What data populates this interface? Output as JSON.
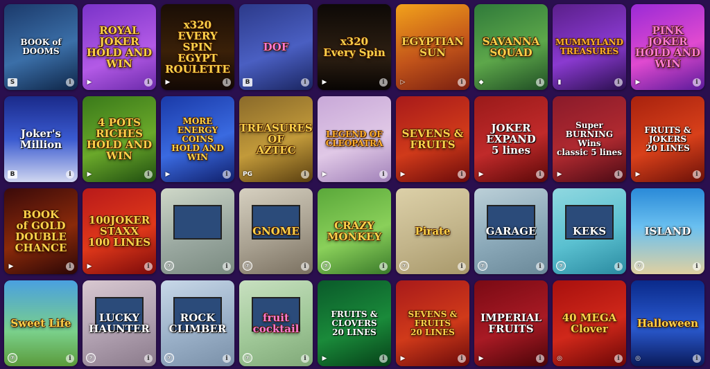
{
  "games": [
    {
      "title": "BOOK of DOOMS",
      "provider": "S",
      "pstyle": "box",
      "bg": "linear-gradient(160deg,#1b3a6b,#3b6fa8 55%,#0e2547)",
      "tcls": "white small"
    },
    {
      "title": "ROYAL\nJOKER\nHOLD AND WIN",
      "provider": "▶",
      "pstyle": "plain",
      "bg": "linear-gradient(160deg,#7a33c9,#b35ae6 60%,#6b2aaa)",
      "tcls": "gold"
    },
    {
      "title": "x320\nEVERY SPIN\nEGYPT ROULETTE",
      "provider": "▶",
      "pstyle": "plain",
      "bg": "linear-gradient(180deg,#1a0e06,#3a2008 55%,#120804)",
      "tcls": "gold"
    },
    {
      "title": "DOF",
      "provider": "B",
      "pstyle": "box",
      "bg": "linear-gradient(160deg,#2c3a8a,#4a5fc2 55%,#1a2560)",
      "tcls": "pink"
    },
    {
      "title": "x320\nEvery Spin",
      "provider": "▶",
      "pstyle": "plain",
      "bg": "linear-gradient(180deg,#0d0906,#2d1f12 60%,#080503)",
      "tcls": "gold"
    },
    {
      "title": "EGYPTIAN\nSUN",
      "provider": "▷",
      "pstyle": "plain",
      "bg": "linear-gradient(160deg,#f2a21b,#c2541a 55%,#7a1f10)",
      "tcls": "gold"
    },
    {
      "title": "SAVANNA\nSQUAD",
      "provider": "◆",
      "pstyle": "plain",
      "bg": "linear-gradient(160deg,#2f7a3a,#5da74a 55%,#1f4d24)",
      "tcls": "gold"
    },
    {
      "title": "MUMMYLAND\nTREASURES",
      "provider": "▮",
      "pstyle": "plain",
      "bg": "linear-gradient(160deg,#5a1f8a,#8a3ad0 55%,#2a0f4e)",
      "tcls": "orange small"
    },
    {
      "title": "PINK\nJOKER\nHOLD AND WIN",
      "provider": "▶",
      "pstyle": "plain",
      "bg": "linear-gradient(160deg,#9a2ad6,#e04ad0 55%,#5a1a9a)",
      "tcls": "pink"
    },
    {
      "title": "Joker's\nMillion",
      "provider": "B",
      "pstyle": "box",
      "bg": "linear-gradient(180deg,#1a2a8a,#3a5ad0 50%,#d0d6f0)",
      "tcls": "white"
    },
    {
      "title": "4 POTS\nRICHES\nHOLD AND WIN",
      "provider": "▶",
      "pstyle": "plain",
      "bg": "linear-gradient(160deg,#3a7a1a,#6aa82a 55%,#1f4d10)",
      "tcls": "gold"
    },
    {
      "title": "MORE\nENERGY\nCOINS\nHOLD AND WIN",
      "provider": "▶",
      "pstyle": "plain",
      "bg": "linear-gradient(160deg,#1a3aa8,#3a6ae0 55%,#101f6a)",
      "tcls": "gold small"
    },
    {
      "title": "TREASURES OF\nAZTEC",
      "provider": "PG",
      "pstyle": "plain",
      "bg": "linear-gradient(160deg,#8a6a2a,#c29a3a 55%,#5a3f10)",
      "tcls": "gold"
    },
    {
      "title": "LEGEND OF\nCLEOPATRA",
      "provider": "▶",
      "pstyle": "plain",
      "bg": "linear-gradient(160deg,#c8a8d8,#e0c8e6 55%,#a080b8)",
      "tcls": "orange small"
    },
    {
      "title": "SEVENS &\nFRUITS",
      "provider": "▶",
      "pstyle": "plain",
      "bg": "linear-gradient(160deg,#a81a1a,#d03a1a 55%,#6a0a0a)",
      "tcls": "gold"
    },
    {
      "title": "JOKER\nEXPAND\n5 lines",
      "provider": "▶",
      "pstyle": "plain",
      "bg": "linear-gradient(160deg,#9a1a1a,#c02a2a 55%,#5a0808)",
      "tcls": "white"
    },
    {
      "title": "Super\nBURNING Wins\nclassic 5 lines",
      "provider": "▶",
      "pstyle": "plain",
      "bg": "linear-gradient(160deg,#8a1a2a,#b02a30 55%,#4a0a14)",
      "tcls": "white small"
    },
    {
      "title": "FRUITS & JOKERS\n20 LINES",
      "provider": "▶",
      "pstyle": "plain",
      "bg": "linear-gradient(160deg,#a8220e,#d8401a 55%,#6a1008)",
      "tcls": "white small"
    },
    {
      "title": "BOOK\nof GOLD\nDOUBLE CHANCE",
      "provider": "▶",
      "pstyle": "plain",
      "bg": "linear-gradient(160deg,#3a0a0a,#8a2a0a 55%,#2a0606)",
      "tcls": "gold"
    },
    {
      "title": "100JOKER\nSTAXX\n100 LINES",
      "provider": "▶",
      "pstyle": "plain",
      "bg": "linear-gradient(160deg,#b81a1a,#e0381a 55%,#7a0a0a)",
      "tcls": "gold"
    },
    {
      "title": "",
      "provider": "⑦",
      "pstyle": "circle",
      "bg": "linear-gradient(160deg,#cfd8c8,#9aa8a0 55%,#7a8a80)",
      "tcls": "white",
      "pixel": true
    },
    {
      "title": "GNOME",
      "provider": "⑦",
      "pstyle": "circle",
      "bg": "linear-gradient(160deg,#d6d0c0,#a8a090 55%,#7a7060)",
      "tcls": "gold",
      "pixel": true
    },
    {
      "title": "CRAZY\nMONKEY",
      "provider": "⑦",
      "pstyle": "circle",
      "bg": "linear-gradient(160deg,#5aa83a,#8ad05a 55%,#3a7a2a)",
      "tcls": "gold"
    },
    {
      "title": "Pirate",
      "provider": "⑦",
      "pstyle": "circle",
      "bg": "linear-gradient(160deg,#dcd0a8,#c2b48a 55%,#a8986a)",
      "tcls": "gold"
    },
    {
      "title": "GARAGE",
      "provider": "⑦",
      "pstyle": "circle",
      "bg": "linear-gradient(160deg,#bcd0d8,#8aa8b8 55%,#6a8898)",
      "tcls": "white",
      "pixel": true
    },
    {
      "title": "KEKS",
      "provider": "⑦",
      "pstyle": "circle",
      "bg": "linear-gradient(160deg,#90d8e0,#5ac0d0 55%,#2a8aa0)",
      "tcls": "white",
      "pixel": true
    },
    {
      "title": "ISLAND",
      "provider": "⑦",
      "pstyle": "circle",
      "bg": "linear-gradient(180deg,#2a8ad8,#6ac0f0 45%,#e0d0a0)",
      "tcls": "white"
    },
    {
      "title": "Sweet Life",
      "provider": "⑦",
      "pstyle": "circle",
      "bg": "linear-gradient(180deg,#4aa0e0,#7ad08a 60%,#5a9a3a)",
      "tcls": "gold"
    },
    {
      "title": "LUCKY\nHAUNTER",
      "provider": "⑦",
      "pstyle": "circle",
      "bg": "linear-gradient(160deg,#d8c8d0,#b0a0b0 55%,#8a7a8a)",
      "tcls": "white",
      "pixel": true
    },
    {
      "title": "ROCK\nCLIMBER",
      "provider": "⑦",
      "pstyle": "circle",
      "bg": "linear-gradient(160deg,#c8d8e8,#9ab0c8 55%,#7a90a8)",
      "tcls": "white",
      "pixel": true
    },
    {
      "title": "fruit\ncocktail",
      "provider": "⑦",
      "pstyle": "circle",
      "bg": "linear-gradient(160deg,#c8e0c0,#a0c898 55%,#80a878)",
      "tcls": "pink",
      "pixel": true
    },
    {
      "title": "FRUITS & CLOVERS\n20 LINES",
      "provider": "▶",
      "pstyle": "plain",
      "bg": "linear-gradient(160deg,#0a5a2a,#1a8a3a 55%,#064018)",
      "tcls": "white small"
    },
    {
      "title": "SEVENS & FRUITS\n20 LINES",
      "provider": "▶",
      "pstyle": "plain",
      "bg": "linear-gradient(160deg,#a81a1a,#d03a1a 55%,#6a0a0a)",
      "tcls": "gold small"
    },
    {
      "title": "IMPERIAL\nFRUITS",
      "provider": "▶",
      "pstyle": "plain",
      "bg": "linear-gradient(160deg,#7a0a14,#a81a24 55%,#4a0408)",
      "tcls": "white"
    },
    {
      "title": "40 MEGA\nClover",
      "provider": "◎",
      "pstyle": "plain",
      "bg": "linear-gradient(160deg,#a8100e,#d0281a 55%,#6a0606)",
      "tcls": "gold"
    },
    {
      "title": "Halloween",
      "provider": "◎",
      "pstyle": "plain",
      "bg": "linear-gradient(180deg,#0a2a8a,#2a5ad0 55%,#0a1a5a)",
      "tcls": "gold"
    }
  ]
}
